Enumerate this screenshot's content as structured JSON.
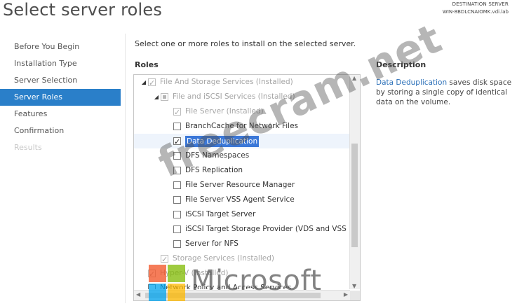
{
  "page": {
    "title": "Select server roles",
    "destination_label": "DESTINATION SERVER",
    "destination_server": "WIN-8BDLCNAIOMK.vdi.lab"
  },
  "nav": {
    "items": [
      {
        "label": "Before You Begin",
        "state": "normal"
      },
      {
        "label": "Installation Type",
        "state": "normal"
      },
      {
        "label": "Server Selection",
        "state": "normal"
      },
      {
        "label": "Server Roles",
        "state": "selected"
      },
      {
        "label": "Features",
        "state": "normal"
      },
      {
        "label": "Confirmation",
        "state": "normal"
      },
      {
        "label": "Results",
        "state": "disabled"
      }
    ]
  },
  "main": {
    "instruction": "Select one or more roles to install on the selected server.",
    "roles_header": "Roles",
    "description_header": "Description",
    "description_link": "Data Deduplication",
    "description_rest": " saves disk space by storing a single copy of identical data on the volume."
  },
  "roles": [
    {
      "label": "File And Storage Services (Installed)",
      "state": "checked-grey",
      "dim": true,
      "expander": "◢",
      "indent": 0
    },
    {
      "label": "File and iSCSI Services (Installed)",
      "state": "partial",
      "dim": true,
      "expander": "◢",
      "indent": 1
    },
    {
      "label": "File Server (Installed)",
      "state": "checked-grey",
      "dim": true,
      "expander": "",
      "indent": 2
    },
    {
      "label": "BranchCache for Network Files",
      "state": "unchecked",
      "dim": false,
      "expander": "",
      "indent": 2
    },
    {
      "label": "Data Deduplication",
      "state": "checked",
      "dim": false,
      "expander": "",
      "indent": 2,
      "selected": true
    },
    {
      "label": "DFS Namespaces",
      "state": "unchecked",
      "dim": false,
      "expander": "",
      "indent": 2
    },
    {
      "label": "DFS Replication",
      "state": "unchecked",
      "dim": false,
      "expander": "",
      "indent": 2
    },
    {
      "label": "File Server Resource Manager",
      "state": "unchecked",
      "dim": false,
      "expander": "",
      "indent": 2
    },
    {
      "label": "File Server VSS Agent Service",
      "state": "unchecked",
      "dim": false,
      "expander": "",
      "indent": 2
    },
    {
      "label": "iSCSI Target Server",
      "state": "unchecked",
      "dim": false,
      "expander": "",
      "indent": 2
    },
    {
      "label": "iSCSI Target Storage Provider (VDS and VSS",
      "state": "unchecked",
      "dim": false,
      "expander": "",
      "indent": 2
    },
    {
      "label": "Server for NFS",
      "state": "unchecked",
      "dim": false,
      "expander": "",
      "indent": 2
    },
    {
      "label": "Storage Services (Installed)",
      "state": "checked-grey",
      "dim": true,
      "expander": "",
      "indent": 1
    },
    {
      "label": "Hyper-V (Installed)",
      "state": "checked-grey",
      "dim": true,
      "expander": "",
      "indent": 0
    },
    {
      "label": "Network Policy and Access Services",
      "state": "unchecked",
      "dim": false,
      "expander": "",
      "indent": 0
    }
  ],
  "watermark": "freecram.net",
  "brand": {
    "name": "Microsoft",
    "colors": [
      "#f25022",
      "#7fba00",
      "#00a4ef",
      "#ffb900"
    ]
  },
  "colors": {
    "accent": "#2a7fc9",
    "selection": "#3b78d8",
    "link": "#2a6fb8"
  }
}
